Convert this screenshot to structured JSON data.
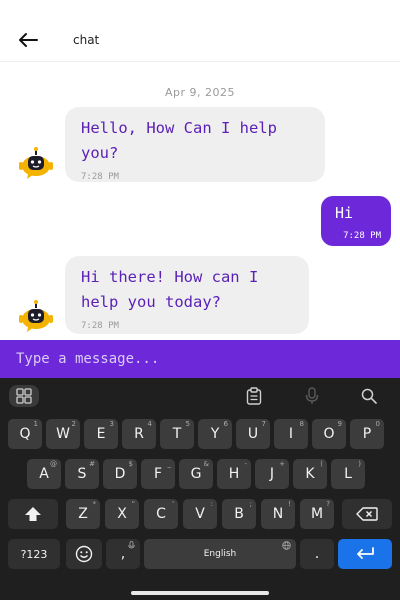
{
  "header": {
    "title": "chat"
  },
  "chat": {
    "date": "Apr 9, 2025",
    "messages": [
      {
        "from": "bot",
        "text": "Hello, How Can I help you?",
        "time": "7:28 PM"
      },
      {
        "from": "user",
        "text": "Hi",
        "time": "7:28 PM"
      },
      {
        "from": "bot",
        "text": "Hi there! How can I help you today?",
        "time": "7:28 PM"
      }
    ]
  },
  "composer": {
    "placeholder": "Type a message..."
  },
  "keyboard": {
    "row1": [
      {
        "label": "Q",
        "sup": "1"
      },
      {
        "label": "W",
        "sup": "2"
      },
      {
        "label": "E",
        "sup": "3"
      },
      {
        "label": "R",
        "sup": "4"
      },
      {
        "label": "T",
        "sup": "5"
      },
      {
        "label": "Y",
        "sup": "6"
      },
      {
        "label": "U",
        "sup": "7"
      },
      {
        "label": "I",
        "sup": "8"
      },
      {
        "label": "O",
        "sup": "9"
      },
      {
        "label": "P",
        "sup": "0"
      }
    ],
    "row2": [
      {
        "label": "A",
        "sup": "@"
      },
      {
        "label": "S",
        "sup": "#"
      },
      {
        "label": "D",
        "sup": "$"
      },
      {
        "label": "F",
        "sup": "_"
      },
      {
        "label": "G",
        "sup": "&"
      },
      {
        "label": "H",
        "sup": "-"
      },
      {
        "label": "J",
        "sup": "+"
      },
      {
        "label": "K",
        "sup": "("
      },
      {
        "label": "L",
        "sup": ")"
      }
    ],
    "row3": [
      {
        "label": "Z",
        "sup": "*"
      },
      {
        "label": "X",
        "sup": "\""
      },
      {
        "label": "C",
        "sup": "'"
      },
      {
        "label": "V",
        "sup": ":"
      },
      {
        "label": "B",
        "sup": ";"
      },
      {
        "label": "N",
        "sup": "!"
      },
      {
        "label": "M",
        "sup": "?"
      }
    ],
    "symbols_label": "?123",
    "comma_label": ",",
    "space_label": "English",
    "period_label": "."
  },
  "colors": {
    "accent": "#6d28d9",
    "bot_text": "#5b21b6",
    "enter_key": "#1a73e8"
  }
}
